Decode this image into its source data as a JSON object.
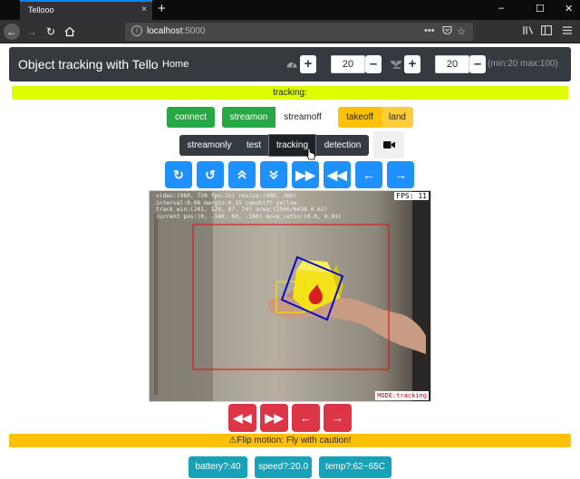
{
  "browser": {
    "tab_title": "Tellooo",
    "tab_close": "×",
    "new_tab": "+",
    "url_host": "localhost",
    "url_port": ":5000",
    "url_more": "•••",
    "window_controls": [
      "–",
      "☐",
      "✕"
    ]
  },
  "app": {
    "brand": "Object tracking with Tello",
    "home": "Home",
    "speed_value": "20",
    "distance_value": "20",
    "range_note": "(min:20 max:100)",
    "plus": "+",
    "minus": "–"
  },
  "status": {
    "tracking_text": "tracking:",
    "warning_text": "Flip motion: Fly with caution!",
    "warning_icon": "⚠"
  },
  "buttons": {
    "connect": "connect",
    "streamon": "streamon",
    "streamoff": "streamoff",
    "takeoff": "takeoff",
    "land": "land",
    "modes": [
      "streamonly",
      "test",
      "tracking",
      "detection"
    ],
    "active_mode": "tracking"
  },
  "move_buttons": [
    "rotate-clockwise",
    "rotate-counterclockwise",
    "up",
    "down",
    "forward",
    "back",
    "left",
    "right"
  ],
  "flip_buttons": [
    "flip-back",
    "flip-forward",
    "flip-left",
    "flip-right"
  ],
  "video": {
    "fps": "FPS: 11",
    "mode": "MODE:tracking",
    "osd_lines": [
      "video:(960, 720 fps:25) resize:(480, 360)",
      "interval:0.06 margin:0.15 camshift yellow",
      "track win:(241, 129, 87, 74) area:(2500/6438 0.62)",
      "current pos:(0, -140, 60, -180) move_ratio:(0.0, 0.03)"
    ]
  },
  "info_buttons": [
    "battery?:40",
    "speed?:20.0",
    "temp?:62~65C"
  ],
  "colors": {
    "accent_blue": "#1e90ff",
    "tracking_bar": "#ddff00",
    "warning": "#ffc107",
    "success": "#28a745",
    "danger": "#dc3545",
    "info": "#17a2b8",
    "navbar": "#343a40"
  }
}
